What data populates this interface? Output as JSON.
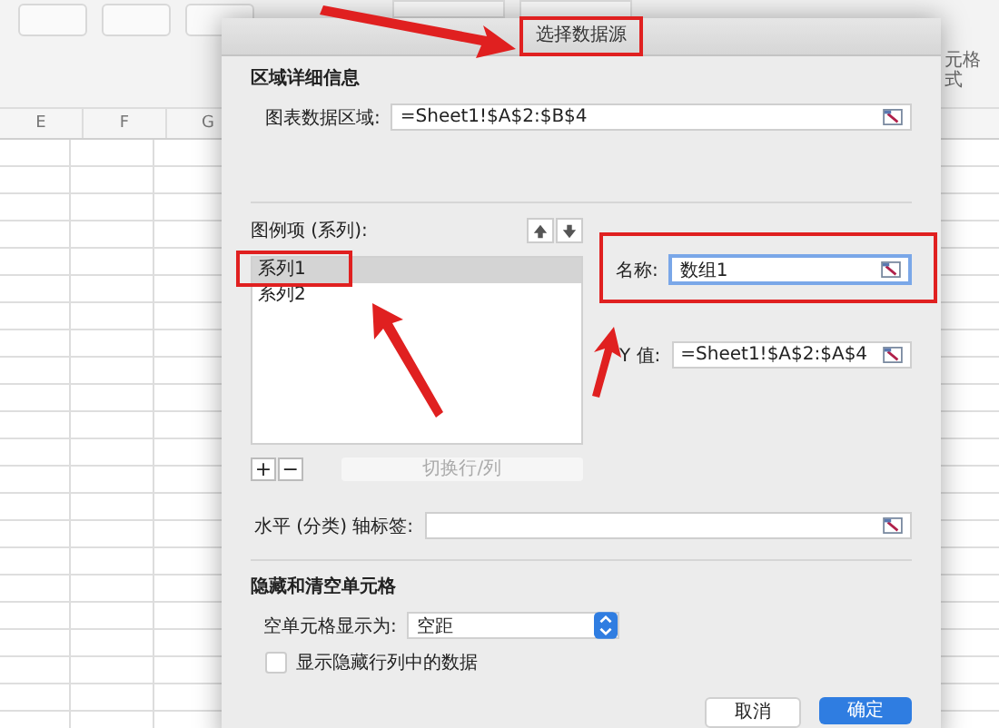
{
  "toolbar": {
    "side_label_lines": [
      "元格",
      "式"
    ]
  },
  "sheet": {
    "columns": [
      "E",
      "F",
      "G"
    ]
  },
  "dialog": {
    "title": "选择数据源",
    "range_section": {
      "heading": "区域详细信息",
      "label": "图表数据区域:",
      "value": "=Sheet1!$A$2:$B$4"
    },
    "series_section": {
      "label": "图例项 (系列):",
      "items": [
        {
          "label": "系列1",
          "selected": true
        },
        {
          "label": "系列2",
          "selected": false
        }
      ],
      "add_button": "+",
      "remove_button": "−",
      "switch_button": {
        "label": "切换行/列",
        "disabled": true
      }
    },
    "name_field": {
      "label": "名称:",
      "value": "数组1",
      "focused": true
    },
    "y_field": {
      "label": "Y 值:",
      "value": "=Sheet1!$A$2:$A$4",
      "focused": false
    },
    "axis_field": {
      "label": "水平 (分类) 轴标签:"
    },
    "hidden_section": {
      "heading": "隐藏和清空单元格",
      "empty_label": "空单元格显示为:",
      "empty_value": "空距",
      "show_hidden": {
        "label": "显示隐藏行列中的数据",
        "checked": false
      }
    },
    "buttons": [
      {
        "label": "取消",
        "kind": "secondary"
      },
      {
        "label": "确定",
        "kind": "primary"
      }
    ]
  }
}
